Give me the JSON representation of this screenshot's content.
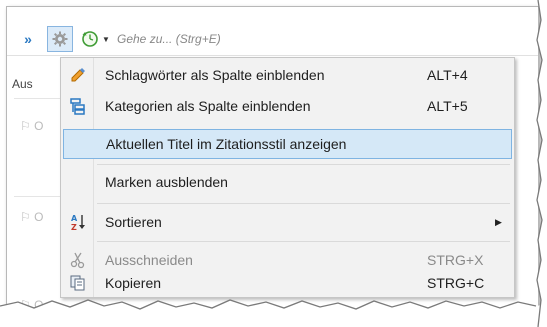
{
  "toolbar": {
    "search_placeholder": "Gehe zu... (Strg+E)",
    "chevron_glyph": "»"
  },
  "left_pane": {
    "column_header": "Aus",
    "row_icon_glyph": "⚐ O"
  },
  "menu": {
    "items": [
      {
        "label": "Schlagwörter als Spalte einblenden",
        "shortcut": "ALT+4",
        "icon": "tag-pencil-icon",
        "state": "normal"
      },
      {
        "label": "Kategorien als Spalte einblenden",
        "shortcut": "ALT+5",
        "icon": "category-tree-icon",
        "state": "normal"
      },
      {
        "label": "Aktuellen Titel im Zitationsstil anzeigen",
        "shortcut": "",
        "icon": "",
        "state": "highlighted"
      },
      {
        "label": "Marken ausblenden",
        "shortcut": "",
        "icon": "",
        "state": "normal"
      },
      {
        "label": "Sortieren",
        "shortcut": "",
        "icon": "sort-az-icon",
        "state": "normal",
        "submenu_arrow": "▶"
      },
      {
        "label": "Ausschneiden",
        "shortcut": "STRG+X",
        "icon": "scissors-icon",
        "state": "disabled"
      },
      {
        "label": "Kopieren",
        "shortcut": "STRG+C",
        "icon": "copy-icon",
        "state": "normal"
      }
    ]
  },
  "colors": {
    "accent": "#2b79c2",
    "highlight_fill": "#d5e8f7",
    "highlight_border": "#7fb4e2",
    "menu_bg": "#f2f2f2",
    "disabled_text": "#8a8a8a"
  }
}
